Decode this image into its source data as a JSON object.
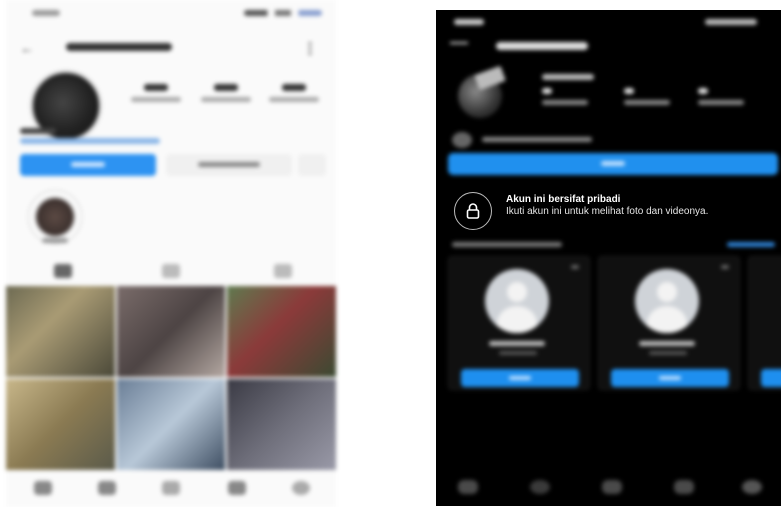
{
  "private_notice": {
    "title": "Akun ini bersifat pribadi",
    "subtitle": "Ikuti akun ini untuk melihat foto dan videonya."
  },
  "icons": {
    "lock": "lock-icon",
    "back": "back-arrow-icon",
    "more": "more-dots-icon",
    "grid": "grid-icon",
    "reels": "reels-icon",
    "tagged": "tagged-icon",
    "home": "home-icon",
    "search": "search-icon",
    "shop": "shop-icon",
    "profile": "profile-icon",
    "close": "close-icon"
  },
  "colors": {
    "accent_blue": "#2090ee",
    "dark_bg": "#000000",
    "light_bg": "#fafafa"
  }
}
